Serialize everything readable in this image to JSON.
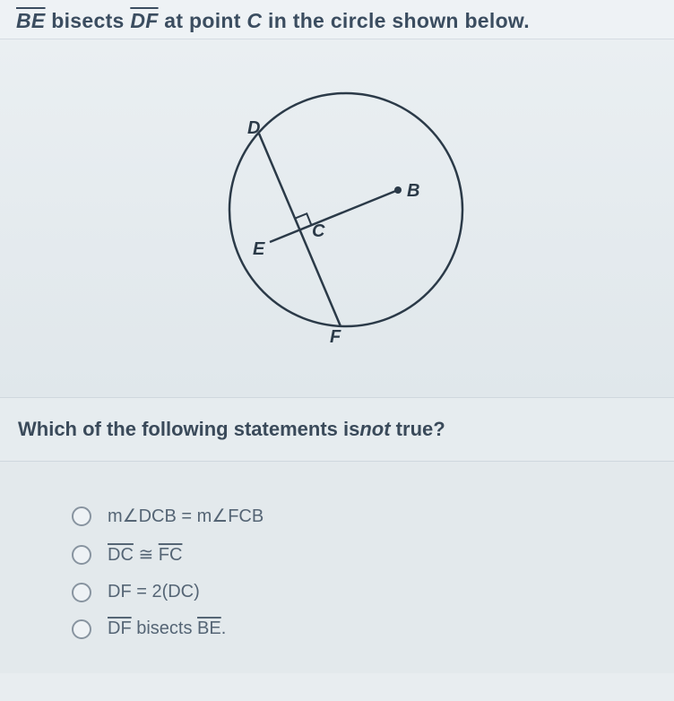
{
  "header": {
    "seg1": "BE",
    "mid1": "  bisects  ",
    "seg2": "DF",
    "mid2": "  at point ",
    "pt": "C",
    "tail": " in the circle shown below."
  },
  "diagram": {
    "labels": {
      "D": "D",
      "E": "E",
      "F": "F",
      "B": "B",
      "C": "C"
    }
  },
  "prompt": {
    "pre": "Which of the following statements is",
    "em": "not",
    "post": " true?"
  },
  "options": {
    "a": "m∠DCB = m∠FCB",
    "b_seg1": "DC",
    "b_mid": " ≅ ",
    "b_seg2": "FC",
    "c": "DF = 2(DC)",
    "d_seg1": "DF",
    "d_mid": " bisects ",
    "d_seg2": "BE",
    "d_tail": "."
  }
}
